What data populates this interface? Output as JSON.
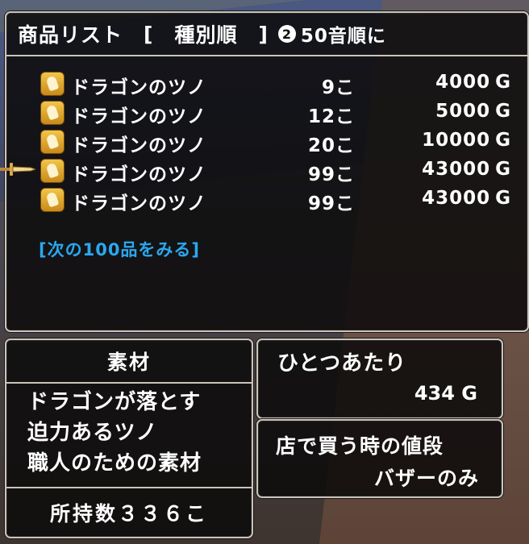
{
  "list": {
    "title": "商品リスト",
    "sort_open": "[",
    "sort_current": "種別順",
    "sort_close": "]",
    "sort_button": "2",
    "sort_alt": "50音順に",
    "items": [
      {
        "name": "ドラゴンのツノ",
        "qty": "9こ",
        "price": "4000",
        "unit": "G"
      },
      {
        "name": "ドラゴンのツノ",
        "qty": "12こ",
        "price": "5000",
        "unit": "G"
      },
      {
        "name": "ドラゴンのツノ",
        "qty": "20こ",
        "price": "10000",
        "unit": "G"
      },
      {
        "name": "ドラゴンのツノ",
        "qty": "99こ",
        "price": "43000",
        "unit": "G"
      },
      {
        "name": "ドラゴンのツノ",
        "qty": "99こ",
        "price": "43000",
        "unit": "G"
      }
    ],
    "selected_index": 3,
    "next_link": "[次の100品をみる]"
  },
  "material": {
    "title": "素材",
    "desc_line1": "ドラゴンが落とす",
    "desc_line2": "迫力あるツノ",
    "desc_line3": "職人のための素材",
    "owned": "所持数３３６こ"
  },
  "unit_price": {
    "label": "ひとつあたり",
    "value": "434",
    "unit": "G"
  },
  "store_price": {
    "label": "店で買う時の値段",
    "value": "バザーのみ"
  },
  "colors": {
    "link": "#2aa8f0",
    "window_bg": "#0c0a0a",
    "frame": "#c9c4bc",
    "item_icon": "#e0a830"
  },
  "icons": {
    "item": "dragon-horn-icon",
    "cursor": "sword-cursor-icon"
  }
}
